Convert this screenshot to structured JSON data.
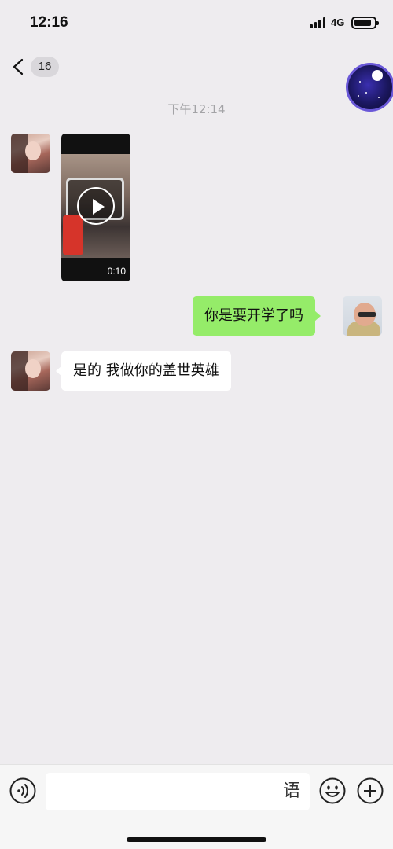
{
  "status_bar": {
    "time": "12:16",
    "network": "4G"
  },
  "nav": {
    "unread_count": "16"
  },
  "chat": {
    "timestamp": "下午12:14",
    "messages": [
      {
        "side": "in",
        "type": "video",
        "duration": "0:10"
      },
      {
        "side": "out",
        "type": "text",
        "text": "你是要开学了吗"
      },
      {
        "side": "in",
        "type": "text",
        "text": "是的 我做你的盖世英雄"
      }
    ]
  },
  "input_bar": {
    "value": "",
    "placeholder": "",
    "ime_label": "语"
  },
  "colors": {
    "background": "#eeecef",
    "outgoing_bubble": "#95ec69",
    "incoming_bubble": "#ffffff"
  }
}
